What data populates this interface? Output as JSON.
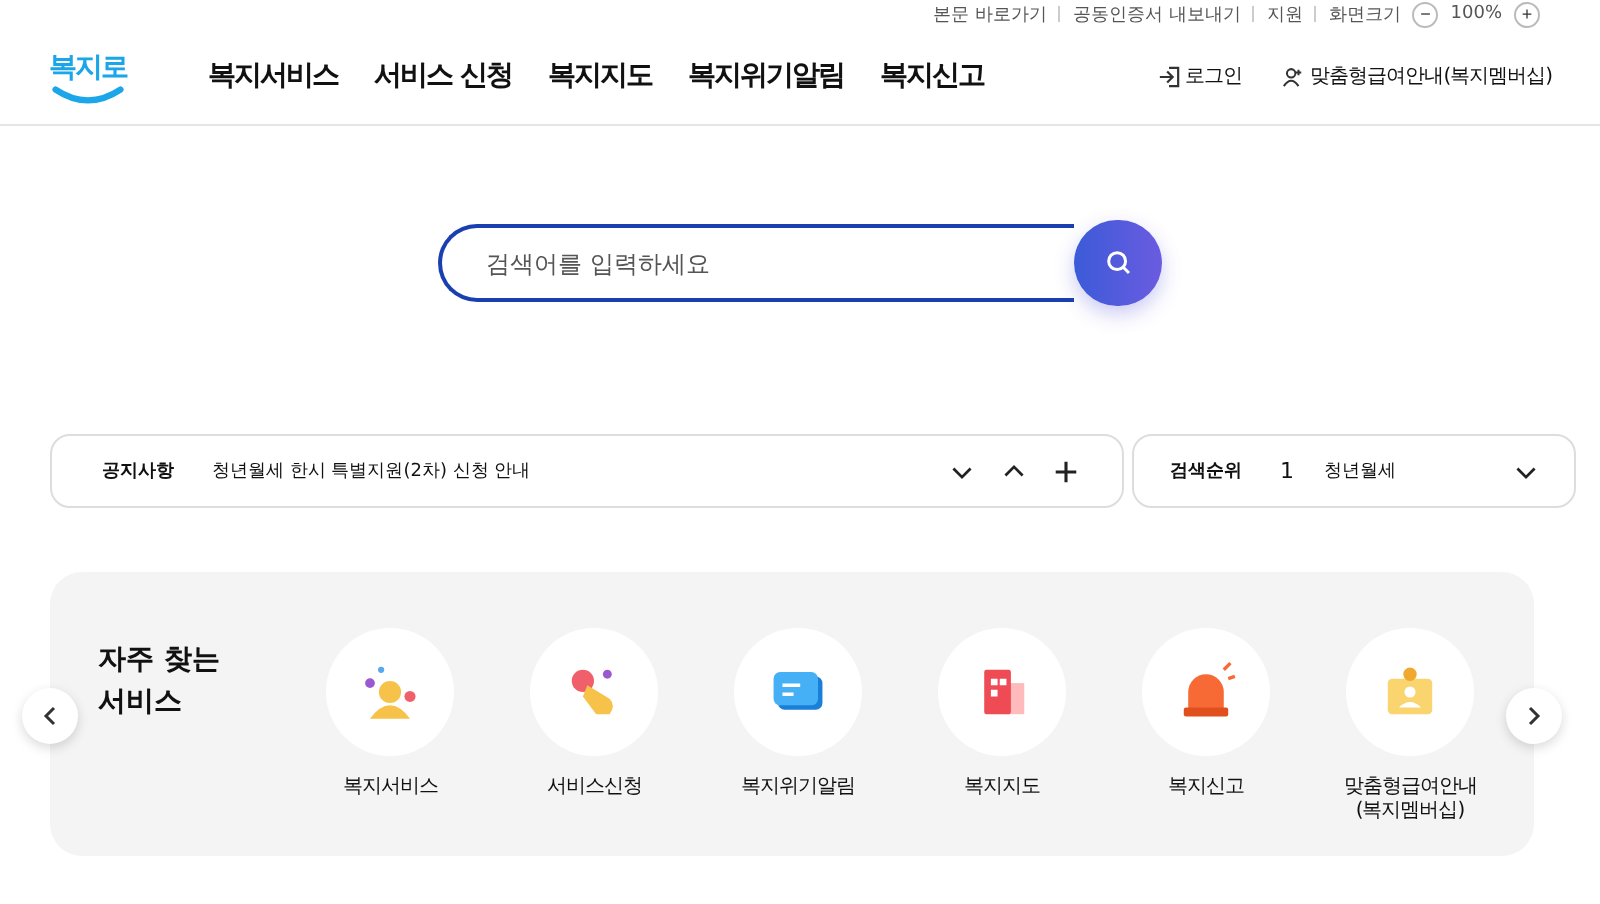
{
  "utility_bar": {
    "links": [
      "본문 바로가기",
      "공동인증서 내보내기",
      "지원"
    ],
    "font_size": {
      "label": "화면크기",
      "decrease": "−",
      "value": "100%",
      "increase": "+"
    }
  },
  "header": {
    "logo": "복지로",
    "nav": [
      {
        "label": "복지서비스"
      },
      {
        "label": "서비스 신청"
      },
      {
        "label": "복지지도"
      },
      {
        "label": "복지위기알림"
      },
      {
        "label": "복지신고"
      }
    ],
    "login": "로그인",
    "membership": "맞춤형급여안내(복지멤버십)"
  },
  "search": {
    "placeholder": "검색어를 입력하세요"
  },
  "notice": {
    "label": "공지사항",
    "text": "청년월세 한시 특별지원(2차) 신청 안내"
  },
  "search_rank": {
    "label": "검색순위",
    "rank": "1",
    "term": "청년월세"
  },
  "frequent": {
    "title": "자주 찾는\n서비스",
    "items": [
      {
        "kind": "person",
        "label": "복지서비스"
      },
      {
        "kind": "hand",
        "label": "서비스신청"
      },
      {
        "kind": "message",
        "label": "복지위기알림"
      },
      {
        "kind": "building",
        "label": "복지지도"
      },
      {
        "kind": "siren",
        "label": "복지신고"
      },
      {
        "kind": "card",
        "label": "맞춤형급여안내\n(복지멤버십)"
      }
    ]
  }
}
